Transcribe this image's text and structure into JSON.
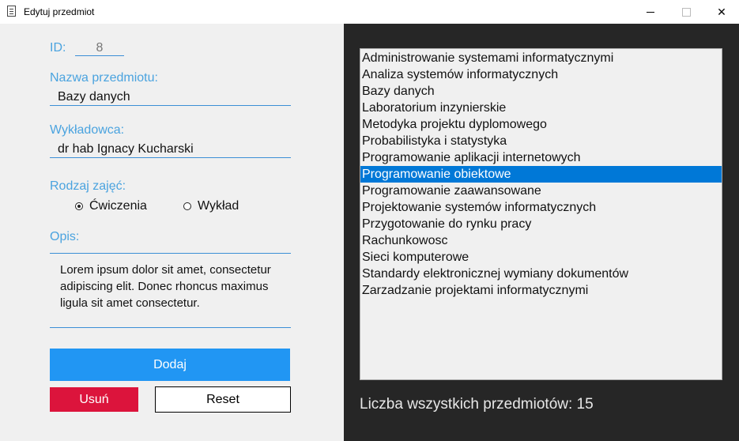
{
  "window": {
    "title": "Edytuj przedmiot"
  },
  "form": {
    "id_label": "ID:",
    "id_value": "8",
    "name_label": "Nazwa przedmiotu:",
    "name_value": "Bazy danych",
    "lecturer_label": "Wykładowca:",
    "lecturer_value": "dr hab Ignacy Kucharski",
    "type_label": "Rodzaj zajęć:",
    "type_options": [
      {
        "label": "Ćwiczenia",
        "selected": true
      },
      {
        "label": "Wykład",
        "selected": false
      }
    ],
    "desc_label": "Opis:",
    "desc_value": "Lorem ipsum dolor sit amet, consectetur adipiscing elit. Donec rhoncus maximus ligula sit amet consectetur."
  },
  "buttons": {
    "add": "Dodaj",
    "delete": "Usuń",
    "reset": "Reset"
  },
  "subjects": {
    "items": [
      "Administrowanie systemami informatycznymi",
      "Analiza systemów informatycznych",
      "Bazy danych",
      "Laboratorium inzynierskie",
      "Metodyka projektu dyplomowego",
      "Probabilistyka i statystyka",
      "Programowanie aplikacji internetowych",
      "Programowanie obiektowe",
      "Programowanie zaawansowane",
      "Projektowanie systemów informatycznych",
      "Przygotowanie do rynku pracy",
      "Rachunkowosc",
      "Sieci komputerowe",
      "Standardy elektronicznej wymiany dokumentów",
      "Zarzadzanie projektami informatycznymi"
    ],
    "selected_index": 7,
    "count_text": "Liczba wszystkich przedmiotów: 15"
  },
  "colors": {
    "accent": "#2196f3",
    "label": "#4aa3df",
    "danger": "#dc143c",
    "selection": "#0078d7",
    "panel_dark": "#262626"
  }
}
